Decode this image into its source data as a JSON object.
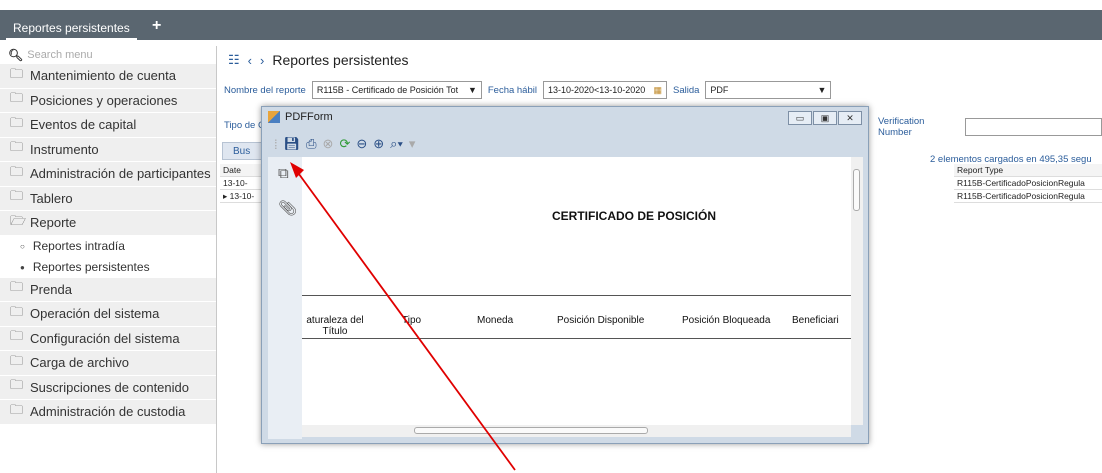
{
  "top_tabs": {
    "active": "Reportes persistentes",
    "add": "+"
  },
  "sidebar": {
    "search_placeholder": "Search menu",
    "items": [
      "Mantenimiento de cuenta",
      "Posiciones y operaciones",
      "Eventos de capital",
      "Instrumento",
      "Administración de participantes",
      "Tablero",
      "Reporte"
    ],
    "report_sub": [
      "Reportes intradía",
      "Reportes persistentes"
    ],
    "items_after": [
      "Prenda",
      "Operación del sistema",
      "Configuración del sistema",
      "Carga de archivo",
      "Suscripciones de contenido",
      "Administración de custodia"
    ]
  },
  "main": {
    "breadcrumb": "Reportes persistentes",
    "nombre_label": "Nombre del reporte",
    "nombre_value": "R115B - Certificado de Posición Tot",
    "fecha_label": "Fecha hábil",
    "fecha_value": "13-10-2020<13-10-2020",
    "salida_label": "Salida",
    "salida_value": "PDF",
    "tipo_label": "Tipo de C",
    "verification_label": "Verification Number",
    "buscar": "Bus",
    "loaded": "2 elementos cargados en 495,35 segu",
    "grid_left": {
      "header": "Date",
      "rows": [
        "13-10-",
        "13-10-"
      ]
    },
    "grid_right": {
      "header": "Report Type",
      "rows": [
        "R115B-CertificadoPosicionRegula",
        "R115B-CertificadoPosicionRegula"
      ]
    }
  },
  "pdf_window": {
    "title": "PDFForm",
    "certificate_title": "CERTIFICADO DE POSICIÓN",
    "columns": [
      "aturaleza del Título",
      "Tipo",
      "Moneda",
      "Posición Disponible",
      "Posición Bloqueada",
      "Beneficiari"
    ]
  },
  "colors": {
    "topbar": "#5a6670",
    "link": "#2b5d9b",
    "arrow": "#e00000"
  }
}
